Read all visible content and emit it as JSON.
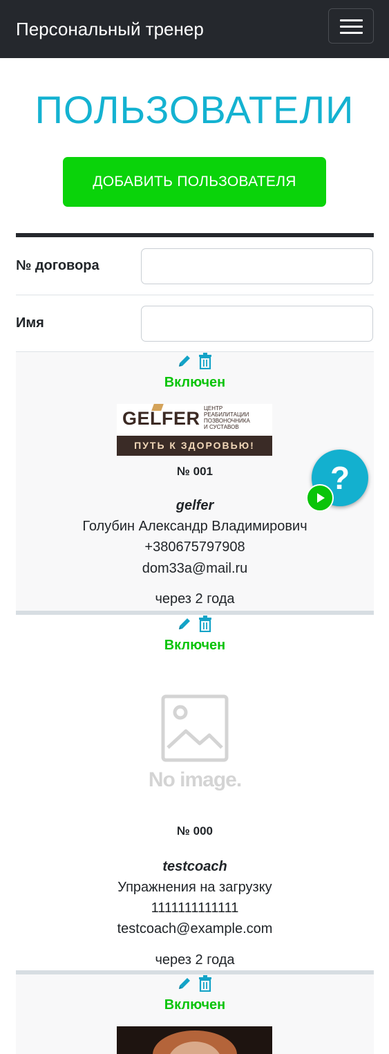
{
  "header": {
    "brand": "Персональный тренер",
    "menu_icon": "hamburger-menu-icon"
  },
  "page": {
    "title": "ПОЛЬЗОВАТЕЛИ",
    "add_button": "ДОБАВИТЬ ПОЛЬЗОВАТЕЛЯ"
  },
  "filters": {
    "contract_label": "№ договора",
    "contract_value": "",
    "name_label": "Имя",
    "name_value": ""
  },
  "users": [
    {
      "status": "Включен",
      "logo_brand": "GELFER",
      "logo_tagline_1": "ЦЕНТР",
      "logo_tagline_2": "РЕАБИЛИТАЦИИ",
      "logo_tagline_3": "ПОЗВОНОЧНИКА",
      "logo_tagline_4": "И СУСТАВОВ",
      "logo_slogan": "ПУТЬ К ЗДОРОВЬЮ!",
      "number": "№ 001",
      "login": "gelfer",
      "name": "Голубин Александр Владимирович",
      "phone": "+380675797908",
      "email": "dom33a@mail.ru",
      "expires": "через 2 года"
    },
    {
      "status": "Включен",
      "image_placeholder": "No image.",
      "number": "№ 000",
      "login": "testcoach",
      "name": "Упражнения на загрузку",
      "phone": "1111111111111",
      "email": "testcoach@example.com",
      "expires": "через 2 года"
    },
    {
      "status": "Включен"
    }
  ],
  "icons": {
    "edit": "pencil-icon",
    "delete": "trash-icon",
    "help": "question-icon",
    "play": "play-icon"
  },
  "help_widget": {
    "label": "?"
  },
  "colors": {
    "accent_title": "#14b2d1",
    "add_button": "#0ad30a",
    "status_enabled": "#0ac40a",
    "navbar": "#25282d",
    "icon": "#14a3c7"
  }
}
